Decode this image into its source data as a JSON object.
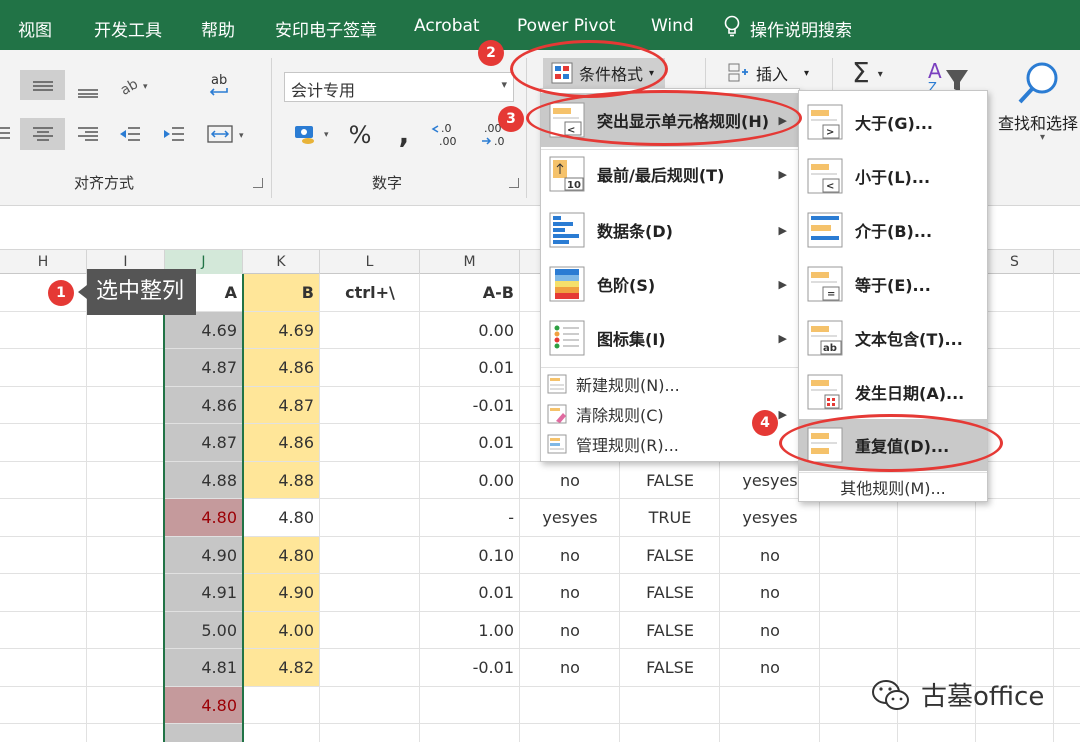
{
  "tabs": [
    "视图",
    "开发工具",
    "帮助",
    "安印电子签章",
    "Acrobat",
    "Power Pivot",
    "Wind",
    "操作说明搜索"
  ],
  "ribbon": {
    "alignment_group_label": "对齐方式",
    "number_group_label": "数字",
    "number_format_value": "会计专用",
    "conditional_format_label": "条件格式",
    "insert_label": "插入",
    "find_select_label": "查找和选择",
    "percent_symbol": "%",
    "comma_symbol": ","
  },
  "columns": [
    "H",
    "I",
    "J",
    "K",
    "L",
    "M",
    "S"
  ],
  "sheet": {
    "header_row": {
      "j": "A",
      "k": "B",
      "l": "ctrl+\\",
      "m": "A-B"
    },
    "rows": [
      {
        "j": "4.69",
        "k": "4.69",
        "m": "0.00",
        "n": "",
        "o": "",
        "p": ""
      },
      {
        "j": "4.87",
        "k": "4.86",
        "m": "0.01",
        "n": "",
        "o": "",
        "p": ""
      },
      {
        "j": "4.86",
        "k": "4.87",
        "m": "-0.01",
        "n": "",
        "o": "",
        "p": ""
      },
      {
        "j": "4.87",
        "k": "4.86",
        "m": "0.01",
        "n": "",
        "o": "",
        "p": ""
      },
      {
        "j": "4.88",
        "k": "4.88",
        "m": "0.00",
        "n": "no",
        "o": "FALSE",
        "p": "yesyes"
      },
      {
        "j": "4.80",
        "k": "4.80",
        "m": "-",
        "n": "yesyes",
        "o": "TRUE",
        "p": "yesyes"
      },
      {
        "j": "4.90",
        "k": "4.80",
        "m": "0.10",
        "n": "no",
        "o": "FALSE",
        "p": "no"
      },
      {
        "j": "4.91",
        "k": "4.90",
        "m": "0.01",
        "n": "no",
        "o": "FALSE",
        "p": "no"
      },
      {
        "j": "5.00",
        "k": "4.00",
        "m": "1.00",
        "n": "no",
        "o": "FALSE",
        "p": "no"
      },
      {
        "j": "4.81",
        "k": "4.82",
        "m": "-0.01",
        "n": "no",
        "o": "FALSE",
        "p": "no"
      },
      {
        "j": "4.80",
        "k": "",
        "m": "",
        "n": "",
        "o": "",
        "p": ""
      }
    ]
  },
  "cf_menu": {
    "items": [
      {
        "label": "突出显示单元格规则(H)",
        "icon": "highlight-rules-icon"
      },
      {
        "label": "最前/最后规则(T)",
        "icon": "top-bottom-icon"
      },
      {
        "label": "数据条(D)",
        "icon": "data-bars-icon"
      },
      {
        "label": "色阶(S)",
        "icon": "color-scales-icon"
      },
      {
        "label": "图标集(I)",
        "icon": "icon-sets-icon"
      }
    ],
    "small_items": [
      {
        "label": "新建规则(N)...",
        "icon": "new-rule-icon"
      },
      {
        "label": "清除规则(C)",
        "icon": "clear-rules-icon"
      },
      {
        "label": "管理规则(R)...",
        "icon": "manage-rules-icon"
      }
    ]
  },
  "highlight_submenu": {
    "items": [
      {
        "label": "大于(G)...",
        "glyph": ">"
      },
      {
        "label": "小于(L)...",
        "glyph": "<"
      },
      {
        "label": "介于(B)...",
        "glyph": ""
      },
      {
        "label": "等于(E)...",
        "glyph": "="
      },
      {
        "label": "文本包含(T)...",
        "glyph": "ab"
      },
      {
        "label": "发生日期(A)...",
        "glyph": ""
      },
      {
        "label": "重复值(D)...",
        "glyph": ""
      }
    ],
    "more_rules": "其他规则(M)..."
  },
  "annotations": {
    "badges": [
      "1",
      "2",
      "3",
      "4"
    ],
    "tooltip": "选中整列"
  },
  "watermark": "古墓office",
  "colors": {
    "excel_green": "#217346",
    "selected_gray": "#c6c6c6",
    "duplicate_red_fill": "#c59a9c",
    "duplicate_red_text": "#9c0006",
    "yellow_fill": "#ffe699",
    "annotation_red": "#e53935"
  }
}
